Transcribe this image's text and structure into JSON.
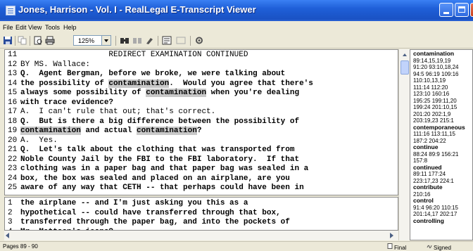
{
  "window": {
    "title": "Jones, Harrison - Vol. I - RealLegal E-Transcript Viewer"
  },
  "menu": [
    "File",
    "Edit",
    "View",
    "Tools",
    "Help"
  ],
  "toolbar": {
    "zoom": "125%"
  },
  "transcript_upper": [
    {
      "n": "11",
      "t": "                   REDIRECT EXAMINATION CONTINUED"
    },
    {
      "n": "12",
      "t": "BY MS. Wallace:"
    },
    {
      "n": "13",
      "t": "Q.  Agent Bergman, before we broke, we were talking about"
    },
    {
      "n": "14",
      "pre": "the possibility of ",
      "hl": "contamination",
      "post": ".  Would you agree that there's"
    },
    {
      "n": "15",
      "pre": "always some possibility of ",
      "hl": "contamination",
      "post": " when you're dealing"
    },
    {
      "n": "16",
      "t": "with trace evidence?"
    },
    {
      "n": "17",
      "t": "A.  I can't rule that out; that's correct."
    },
    {
      "n": "18",
      "t": "Q.  But is there a big difference between the possibility of"
    },
    {
      "n": "19",
      "pre": "",
      "hl": "contamination",
      "mid": " and actual ",
      "hl2": "contamination",
      "post": "?"
    },
    {
      "n": "20",
      "t": "A.  Yes."
    },
    {
      "n": "21",
      "t": "Q.  Let's talk about the clothing that was transported from"
    },
    {
      "n": "22",
      "t": "Noble County Jail by the FBI to the FBI laboratory.  If that"
    },
    {
      "n": "23",
      "t": "clothing was in a paper bag and that paper bag was sealed in a"
    },
    {
      "n": "24",
      "t": "box, the box was sealed and placed on an airplane, are you"
    },
    {
      "n": "25",
      "t": "aware of any way that CETH -- that perhaps could have been in"
    }
  ],
  "transcript_lower": [
    {
      "n": "1",
      "t": "the airplane -- and I'm just asking you this as a"
    },
    {
      "n": "2",
      "t": "hypothetical -- could have transferred through that box,"
    },
    {
      "n": "3",
      "t": "transferred through the paper bag, and into the pockets of"
    },
    {
      "n": "4",
      "t": "Mr. Mattson's jeans?"
    }
  ],
  "word_index": [
    {
      "w": "contamination",
      "refs": [
        "89:14,15,19,19",
        "91:20 93:10,18,24",
        "94:5 96:19 109:16",
        "110:10,13,19",
        "111:14 112:20",
        "123:10 160:16",
        "195:25 199:11,20",
        "199:24 201:10,15",
        "201:20 202:1,9",
        "203:19,23 215:1"
      ]
    },
    {
      "w": "contemporaneous",
      "refs": [
        "111:16 113:11,15",
        "187:2 204:22"
      ]
    },
    {
      "w": "continue",
      "refs": [
        "88:24 89:9 156:21",
        "157:8"
      ]
    },
    {
      "w": "continued",
      "refs": [
        "89:11 177:24",
        "223:17,23 224:1"
      ]
    },
    {
      "w": "contribute",
      "refs": [
        "210:16"
      ]
    },
    {
      "w": "control",
      "refs": [
        "91:4 96:20 110:15",
        "201:14,17 202:17"
      ]
    },
    {
      "w": "controlling",
      "refs": []
    }
  ],
  "status": {
    "pages": "Pages 89 - 90",
    "final": "Final",
    "signed": "Signed"
  }
}
